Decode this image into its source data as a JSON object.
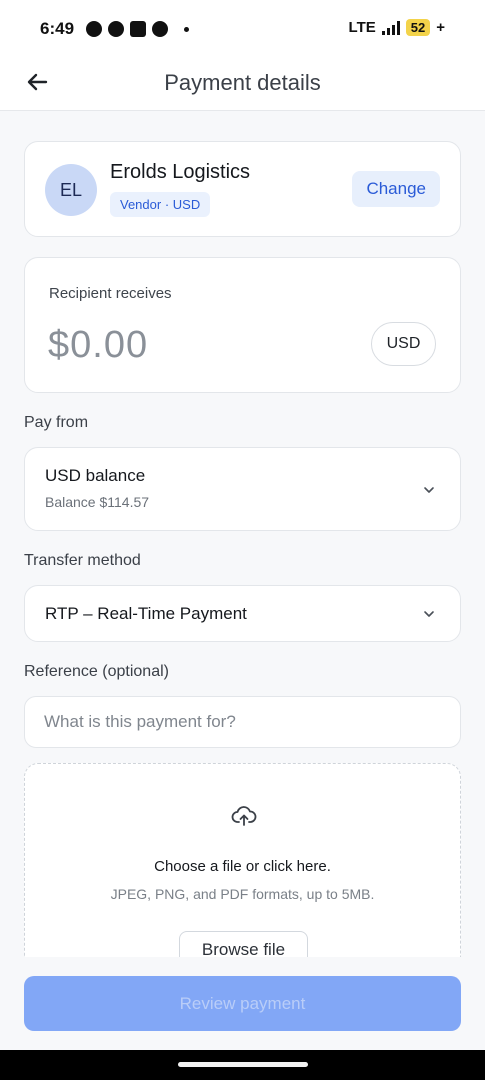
{
  "status_bar": {
    "time": "6:49",
    "network": "LTE",
    "battery": "52",
    "charging": "+",
    "app_icons": [
      "whatsapp-icon",
      "snapchat-icon",
      "linkedin-icon",
      "messenger-icon"
    ]
  },
  "header": {
    "title": "Payment details",
    "back_icon": "arrow-left-icon"
  },
  "recipient": {
    "initials": "EL",
    "name": "Erolds Logistics",
    "badge": "Vendor · USD",
    "change_label": "Change"
  },
  "amount": {
    "label": "Recipient receives",
    "value": "$0.00",
    "currency": "USD"
  },
  "pay_from": {
    "label": "Pay from",
    "selected": "USD balance",
    "balance": "Balance $114.57"
  },
  "transfer_method": {
    "label": "Transfer method",
    "selected": "RTP – Real-Time Payment"
  },
  "reference": {
    "label": "Reference (optional)",
    "placeholder": "What is this payment for?"
  },
  "upload": {
    "icon": "cloud-upload-icon",
    "title": "Choose a file or click here.",
    "subtitle": "JPEG, PNG, and PDF formats, up to 5MB.",
    "browse_label": "Browse file"
  },
  "actions": {
    "review_label": "Review payment"
  },
  "colors": {
    "accent": "#2a5bd7",
    "primary_disabled": "#82a7f6",
    "avatar_bg": "#c9d8f6",
    "battery": "#f3d34a"
  }
}
